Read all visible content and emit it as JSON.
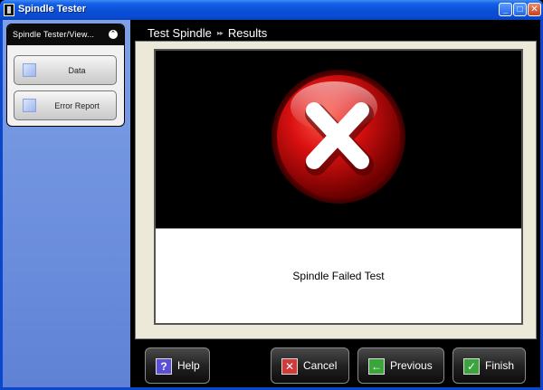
{
  "window": {
    "title": "Spindle Tester",
    "minimize_glyph": "_",
    "maximize_glyph": "□",
    "close_glyph": "✕"
  },
  "sidebar": {
    "header": "Spindle Tester/View...",
    "collapse_glyph": "⌃",
    "items": [
      {
        "label": "Data"
      },
      {
        "label": "Error Report"
      }
    ]
  },
  "breadcrumb": {
    "items": [
      "Test Spindle",
      "Results"
    ],
    "separator": "▸▸"
  },
  "result": {
    "status": "Spindle Failed Test",
    "icon": "fail-x-icon"
  },
  "buttons": {
    "help": {
      "label": "Help",
      "glyph": "?"
    },
    "cancel": {
      "label": "Cancel",
      "glyph": "✕"
    },
    "previous": {
      "label": "Previous",
      "glyph": "←"
    },
    "finish": {
      "label": "Finish",
      "glyph": "✓"
    }
  },
  "colors": {
    "title_bar": "#0a4fd8",
    "sidebar": "#6b8ed9",
    "fail_red": "#d01010",
    "content_bg": "#ece9d8"
  }
}
